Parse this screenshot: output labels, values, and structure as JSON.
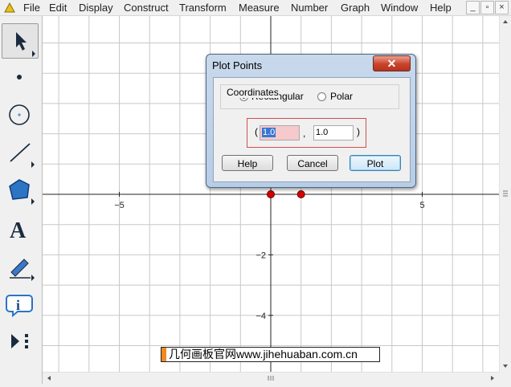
{
  "menubar": {
    "items": [
      {
        "label": "File"
      },
      {
        "label": "Edit"
      },
      {
        "label": "Display"
      },
      {
        "label": "Construct"
      },
      {
        "label": "Transform"
      },
      {
        "label": "Measure"
      },
      {
        "label": "Number"
      },
      {
        "label": "Graph"
      },
      {
        "label": "Window"
      },
      {
        "label": "Help"
      }
    ],
    "window_buttons": {
      "minimize": "_",
      "restore": "▫",
      "close": "×"
    }
  },
  "toolbox": {
    "tools": [
      "arrow-select-tool",
      "point-tool",
      "compass-tool",
      "straightedge-tool",
      "polygon-tool",
      "text-tool",
      "marker-tool",
      "information-tool",
      "custom-tool"
    ],
    "text_tool_glyph": "A",
    "info_tool_glyph": "i"
  },
  "graph": {
    "x_ticks": [
      {
        "label": "−5",
        "value": -5
      },
      {
        "label": "5",
        "value": 5
      }
    ],
    "y_ticks": [
      {
        "label": "−2",
        "value": -2
      },
      {
        "label": "−4",
        "value": -4
      }
    ],
    "points": [
      {
        "x": 0,
        "y": 0
      },
      {
        "x": 1,
        "y": 0
      }
    ],
    "point_color": "#d40000",
    "grid_color": "#c8c8c8"
  },
  "dialog": {
    "title": "Plot Points",
    "close_label": "✕",
    "coordinates_label": "Coordinates",
    "rectangular_label": "Rectangular",
    "polar_label": "Polar",
    "selected_mode": "Rectangular",
    "open_paren": "(",
    "close_paren": ")",
    "separator": ",",
    "x_value": "1.0",
    "y_value": "1.0",
    "help_label": "Help",
    "cancel_label": "Cancel",
    "plot_label": "Plot"
  },
  "watermark": {
    "text": "几何画板官网www.jihehuaban.com.cn"
  }
}
